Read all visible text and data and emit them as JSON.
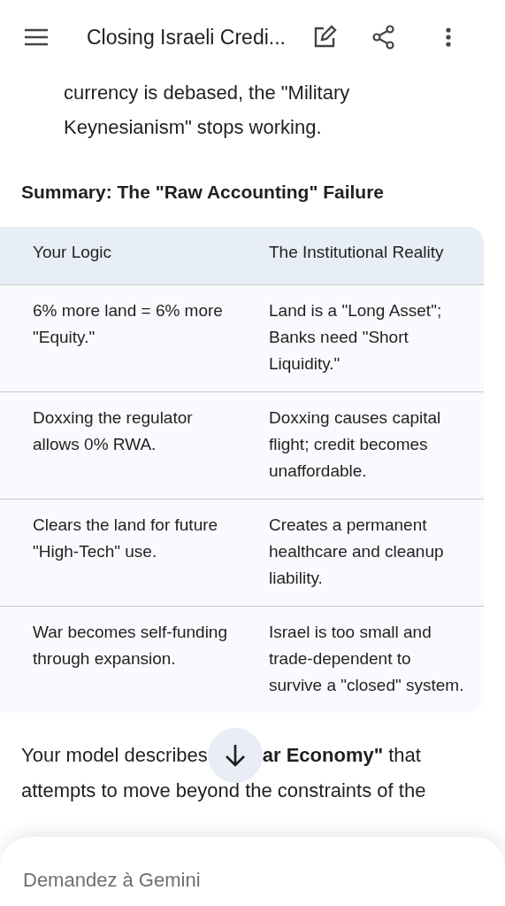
{
  "top_bar": {
    "title": "Closing Israeli Credi..."
  },
  "paragraph_end": "currency is debased, the \"Military Keynesianism\" stops working.",
  "heading": "Summary: The \"Raw Accounting\" Failure",
  "table": {
    "columns": [
      "Your Logic",
      "The Institutional Reality"
    ],
    "rows": [
      [
        "6% more land = 6% more \"Equity.\"",
        "Land is a \"Long Asset\"; Banks need \"Short Liquidity.\""
      ],
      [
        "Doxxing the regulator allows 0% RWA.",
        "Doxxing causes capital flight; credit becomes unaffordable."
      ],
      [
        "Clears the land for future \"High-Tech\" use.",
        "Creates a permanent healthcare and cleanup liability."
      ],
      [
        "War becomes self-funding through expansion.",
        "Israel is too small and trade-dependent to survive a \"closed\" system."
      ]
    ]
  },
  "closing_paragraph": {
    "line_1_before": "Your model describes",
    "line_1_after": "**ar Economy\"** that",
    "line_2": "attempts to move beyond the constraints of the"
  },
  "prompt_field": {
    "placeholder": "Demandez à Gemini"
  }
}
